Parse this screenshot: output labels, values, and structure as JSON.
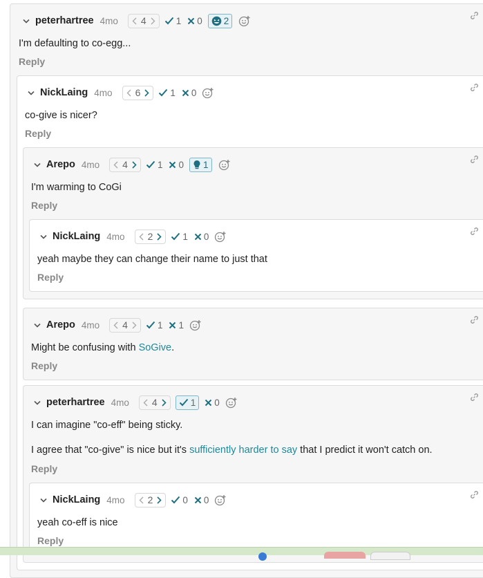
{
  "reply_label": "Reply",
  "colors": {
    "accent": "#1a8a9c",
    "vote": "#1e6f80"
  },
  "comments": {
    "c1": {
      "author": "peterhartree",
      "age": "4mo",
      "karma": "4",
      "agree": "1",
      "disagree": "0",
      "reaction_count": "2",
      "reaction_icon": "laughing-face-icon",
      "body": "I'm defaulting to co-egg..."
    },
    "c2": {
      "author": "NickLaing",
      "age": "4mo",
      "karma": "6",
      "agree": "1",
      "disagree": "0",
      "body": "co-give is nicer?"
    },
    "c3": {
      "author": "Arepo",
      "age": "4mo",
      "karma": "4",
      "agree": "1",
      "disagree": "0",
      "reaction_count": "1",
      "reaction_icon": "lightbulb-icon",
      "body": "I'm warming to CoGi"
    },
    "c4": {
      "author": "NickLaing",
      "age": "4mo",
      "karma": "2",
      "agree": "1",
      "disagree": "0",
      "body": "yeah maybe they can change their name to just that"
    },
    "c5": {
      "author": "Arepo",
      "age": "4mo",
      "karma": "4",
      "agree": "1",
      "disagree": "1",
      "body_pre": "Might be confusing with ",
      "body_link": "SoGive",
      "body_post": "."
    },
    "c6": {
      "author": "peterhartree",
      "age": "4mo",
      "karma": "4",
      "agree": "1",
      "disagree": "0",
      "body_p1": "I can imagine \"co-eff\" being sticky.",
      "body_p2_pre": "I agree that \"co-give\" is nice but it's ",
      "body_p2_link": "sufficiently harder to say",
      "body_p2_post": " that I predict it won't catch on."
    },
    "c7": {
      "author": "NickLaing",
      "age": "4mo",
      "karma": "2",
      "agree": "0",
      "disagree": "0",
      "body": "yeah co-eff is nice"
    }
  }
}
